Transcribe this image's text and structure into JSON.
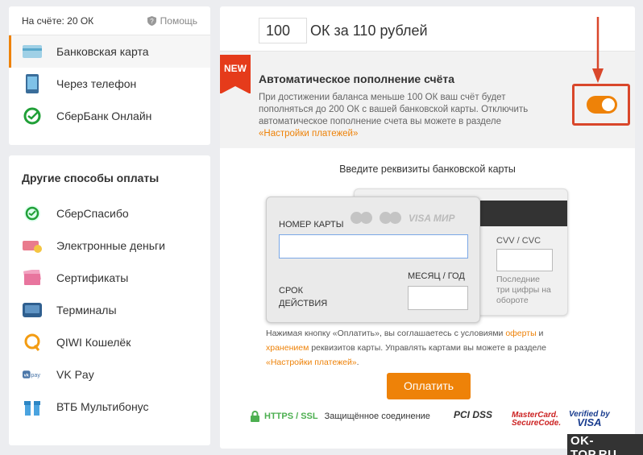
{
  "balance": {
    "text": "На счёте: 20 ОК"
  },
  "help": {
    "label": "Помощь"
  },
  "primary_methods": [
    {
      "label": "Банковская карта",
      "icon": "bank-card-icon"
    },
    {
      "label": "Через телефон",
      "icon": "phone-icon"
    },
    {
      "label": "СберБанк Онлайн",
      "icon": "sberbank-icon"
    }
  ],
  "other_methods": {
    "title": "Другие способы оплаты",
    "items": [
      {
        "label": "СберСпасибо",
        "icon": "sberspasibo-icon"
      },
      {
        "label": "Электронные деньги",
        "icon": "e-money-icon"
      },
      {
        "label": "Сертификаты",
        "icon": "certificate-icon"
      },
      {
        "label": "Терминалы",
        "icon": "terminal-icon"
      },
      {
        "label": "QIWI Кошелёк",
        "icon": "qiwi-icon"
      },
      {
        "label": "VK Pay",
        "icon": "vkpay-icon"
      },
      {
        "label": "ВТБ Мультибонус",
        "icon": "vtb-gift-icon"
      }
    ]
  },
  "purchase": {
    "amount": "100",
    "description": "ОК за 110 рублей"
  },
  "auto_topup": {
    "badge": "NEW",
    "title": "Автоматическое пополнение счёта",
    "desc_main": "При достижении баланса меньше 100 ОК ваш счёт будет пополняться до 200 ОК с вашей банковской карты. Отключить автоматическое пополнение счета вы можете в разделе ",
    "desc_link": "«Настройки платежей»",
    "enabled": true
  },
  "card_form": {
    "title": "Введите реквизиты банковской карты",
    "number_label": "НОМЕР КАРТЫ",
    "brands_text": "VISA МИР",
    "expiry_label_1": "СРОК",
    "expiry_label_2": "ДЕЙСТВИЯ",
    "month_label": "МЕСЯЦ / ГОД",
    "cvv_label": "CVV / CVC",
    "cvv_note": "Последние три цифры на обороте"
  },
  "terms": {
    "t1": "Нажимая кнопку «Оплатить», вы соглашаетесь с условиями ",
    "l1": "оферты",
    "t2": " и ",
    "l2": "хранением",
    "t3": " реквизитов карты. Управлять картами вы можете в разделе ",
    "l3": "«Настройки платежей»",
    "t4": "."
  },
  "pay_button": "Оплатить",
  "security": {
    "https": "HTTPS / SSL",
    "text": "Защищённое соединение",
    "pci": "PCI DSS",
    "mc_1": "MasterCard.",
    "mc_2": "SecureCode.",
    "visa_1": "Verified by",
    "visa_2": "VISA"
  },
  "watermark": "OK-TOP.RU",
  "colors": {
    "accent": "#ee8208",
    "new_badge": "#e53b1b",
    "highlight": "#d9472b"
  }
}
